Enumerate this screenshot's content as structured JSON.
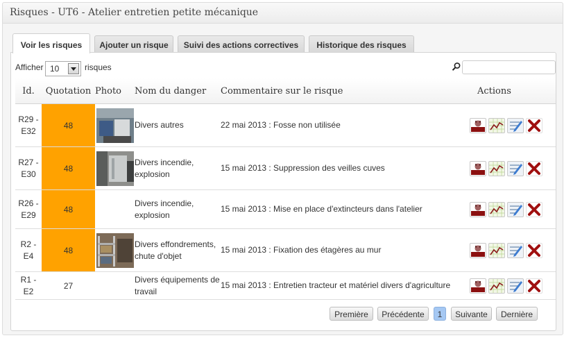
{
  "title": "Risques - UT6 - Atelier entretien petite mécanique",
  "tabs": [
    {
      "label": "Voir les risques",
      "active": true
    },
    {
      "label": "Ajouter un risque",
      "active": false
    },
    {
      "label": "Suivi des actions correctives",
      "active": false
    },
    {
      "label": "Historique des risques",
      "active": false
    }
  ],
  "length": {
    "show_label": "Afficher",
    "value": "10",
    "records_label": "risques"
  },
  "search": {
    "value": ""
  },
  "columns": [
    "Id.",
    "Quotation",
    "Photo",
    "Nom du danger",
    "Commentaire sur le risque",
    "Actions"
  ],
  "rows": [
    {
      "id": "R29 - E32",
      "quotation": "48",
      "highlight": true,
      "danger": "Divers autres",
      "comment": "22 mai 2013 : Fosse non utilisée"
    },
    {
      "id": "R27 - E30",
      "quotation": "48",
      "highlight": true,
      "danger": "Divers incendie, explosion",
      "comment": "15 mai 2013 : Suppression des veilles cuves"
    },
    {
      "id": "R26 - E29",
      "quotation": "48",
      "highlight": true,
      "danger": "Divers incendie, explosion",
      "comment": "15 mai 2013 : Mise en place d'extincteurs dans l'atelier"
    },
    {
      "id": "R2 - E4",
      "quotation": "48",
      "highlight": true,
      "danger": "Divers effondrements, chute d'objet",
      "comment": "15 mai 2013 : Fixation des étagères au mur"
    },
    {
      "id": "R1 - E2",
      "quotation": "27",
      "highlight": false,
      "danger": "Divers équipements de travail",
      "comment": "15 mai 2013 : Entretien tracteur et matériel divers d'agriculture"
    }
  ],
  "pagination": {
    "first": "Première",
    "prev": "Précédente",
    "current": "1",
    "next": "Suivante",
    "last": "Dernière"
  },
  "colors": {
    "quotation_high": "#ffa200",
    "current_page": "#a5c8f3"
  },
  "icons": {
    "search": "magnifier-icon",
    "actions": [
      "risk-evaluation-icon",
      "trend-chart-icon",
      "edit-icon",
      "delete-icon"
    ]
  }
}
